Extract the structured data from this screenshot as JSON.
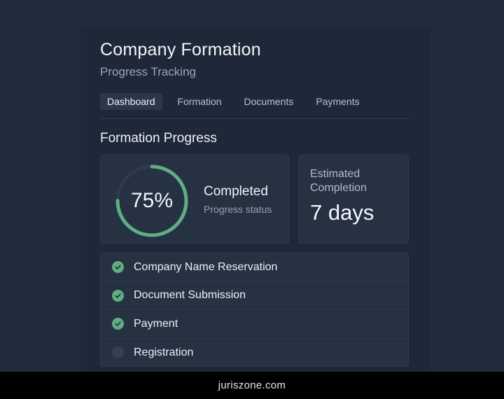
{
  "header": {
    "title": "Company Formation",
    "subtitle": "Progress Tracking"
  },
  "tabs": [
    {
      "label": "Dashboard",
      "active": true
    },
    {
      "label": "Formation",
      "active": false
    },
    {
      "label": "Documents",
      "active": false
    },
    {
      "label": "Payments",
      "active": false
    }
  ],
  "section": {
    "title": "Formation Progress"
  },
  "progress": {
    "percent_label": "75%",
    "percent_value": 0.75,
    "status_label": "Completed",
    "status_sub": "Progress status"
  },
  "estimate": {
    "label": "Estimated Completion",
    "value": "7 days"
  },
  "steps": [
    {
      "label": "Company Name Reservation",
      "done": true,
      "icon": "check-circle-icon"
    },
    {
      "label": "Document Submission",
      "done": true,
      "icon": "check-circle-icon"
    },
    {
      "label": "Payment",
      "done": true,
      "icon": "check-circle-icon"
    },
    {
      "label": "Registration",
      "done": false,
      "icon": "pending-circle-icon"
    }
  ],
  "footer": {
    "text": "juriszone.com"
  },
  "colors": {
    "accent_green": "#5fae82",
    "ring_track": "#2e3a4c",
    "background": "#212b3b",
    "card": "#263142"
  }
}
